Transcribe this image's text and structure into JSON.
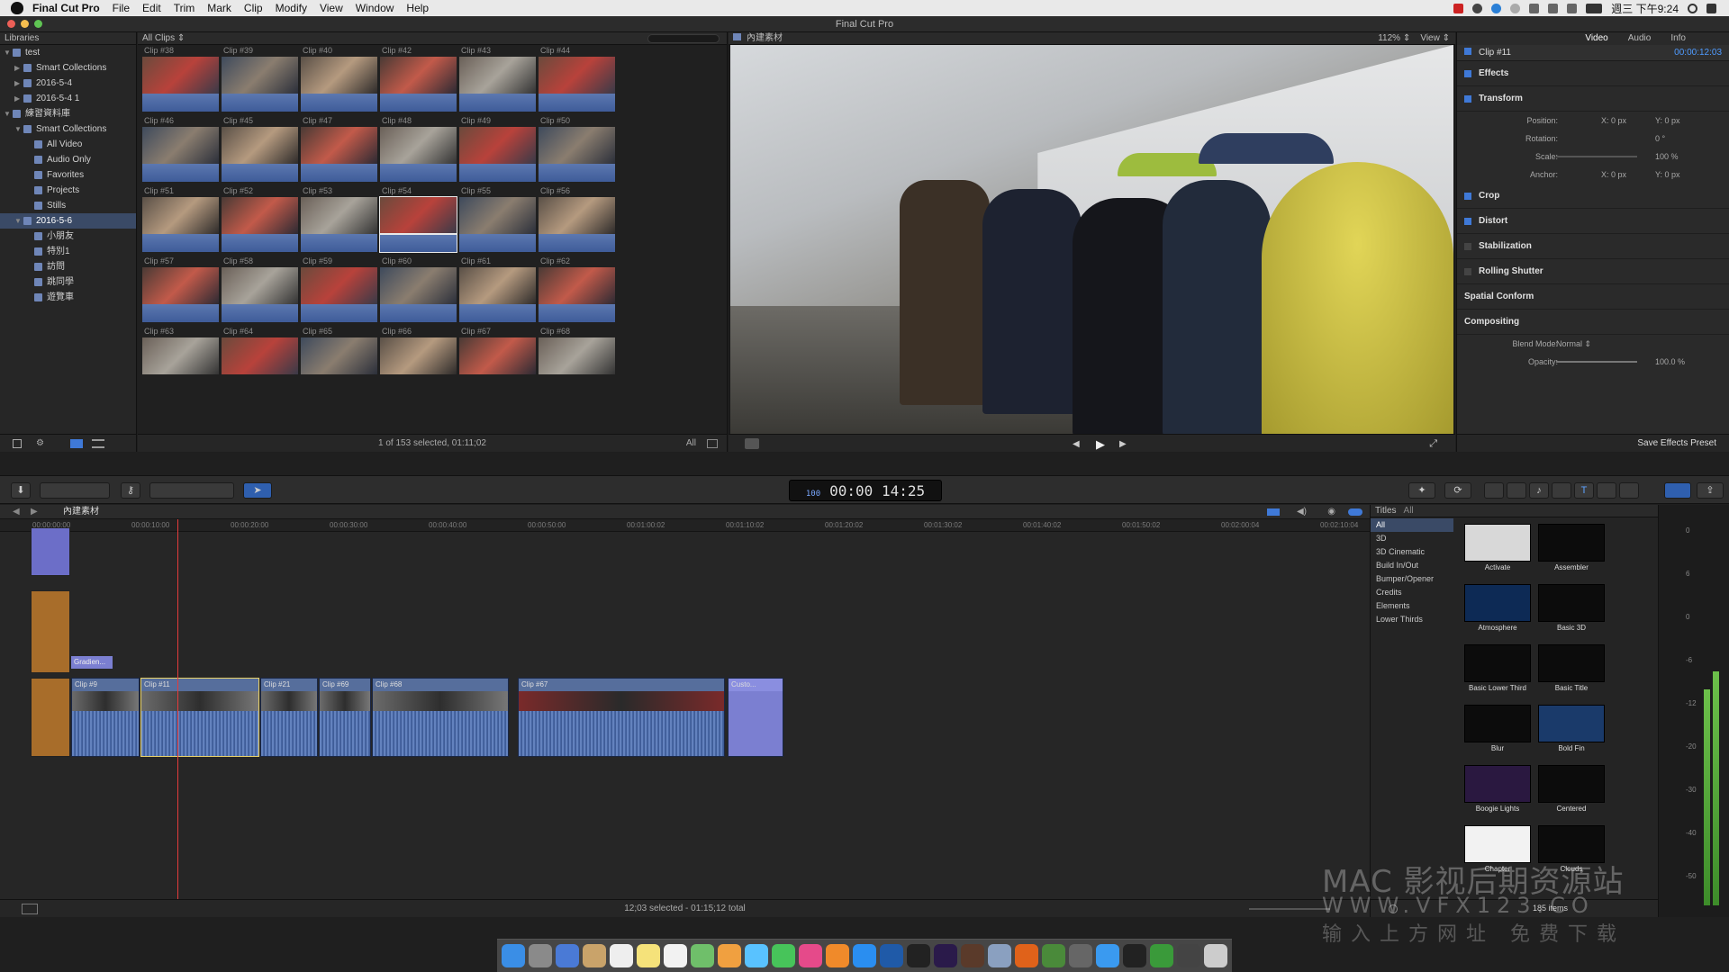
{
  "menubar": {
    "app": "Final Cut Pro",
    "items": [
      "File",
      "Edit",
      "Trim",
      "Mark",
      "Clip",
      "Modify",
      "View",
      "Window",
      "Help"
    ],
    "clock": "週三 下午9:24"
  },
  "window": {
    "title": "Final Cut Pro"
  },
  "libraries": {
    "header": "Libraries",
    "rows": [
      {
        "label": "test",
        "indent": 0,
        "tri": "▼"
      },
      {
        "label": "Smart Collections",
        "indent": 1,
        "tri": "▶"
      },
      {
        "label": "2016-5-4",
        "indent": 1,
        "tri": "▶"
      },
      {
        "label": "2016-5-4 1",
        "indent": 1,
        "tri": "▶"
      },
      {
        "label": "練習資料庫",
        "indent": 0,
        "tri": "▼"
      },
      {
        "label": "Smart Collections",
        "indent": 1,
        "tri": "▼"
      },
      {
        "label": "All Video",
        "indent": 2,
        "tri": ""
      },
      {
        "label": "Audio Only",
        "indent": 2,
        "tri": ""
      },
      {
        "label": "Favorites",
        "indent": 2,
        "tri": ""
      },
      {
        "label": "Projects",
        "indent": 2,
        "tri": ""
      },
      {
        "label": "Stills",
        "indent": 2,
        "tri": ""
      },
      {
        "label": "2016-5-6",
        "indent": 1,
        "tri": "▼",
        "selected": true
      },
      {
        "label": "小朋友",
        "indent": 2,
        "tri": ""
      },
      {
        "label": "特別1",
        "indent": 2,
        "tri": ""
      },
      {
        "label": "訪問",
        "indent": 2,
        "tri": ""
      },
      {
        "label": "跳同學",
        "indent": 2,
        "tri": ""
      },
      {
        "label": "遊覽車",
        "indent": 2,
        "tri": ""
      }
    ]
  },
  "browser": {
    "filter": "All Clips ⇕",
    "clips": [
      "Clip #38",
      "Clip #39",
      "Clip #40",
      "Clip #42",
      "Clip #43",
      "Clip #44",
      "Clip #46",
      "Clip #45",
      "Clip #47",
      "Clip #48",
      "Clip #49",
      "Clip #50",
      "Clip #51",
      "Clip #52",
      "Clip #53",
      "Clip #54",
      "Clip #55",
      "Clip #56",
      "Clip #57",
      "Clip #58",
      "Clip #59",
      "Clip #60",
      "Clip #61",
      "Clip #62",
      "Clip #63",
      "Clip #64",
      "Clip #65",
      "Clip #66",
      "Clip #67",
      "Clip #68"
    ],
    "selected_index": 15,
    "status": "1 of 153 selected, 01:11;02",
    "filter_short": "All"
  },
  "viewer": {
    "title": "內建素材",
    "zoom": "112% ⇕",
    "view_menu": "View ⇕"
  },
  "inspector": {
    "tabs": [
      "Video",
      "Audio",
      "Info"
    ],
    "clip_name": "Clip #11",
    "duration": "00:00:12:03",
    "sections": {
      "effects": "Effects",
      "transform": "Transform",
      "crop": "Crop",
      "distort": "Distort",
      "stabilization": "Stabilization",
      "rolling_shutter": "Rolling Shutter",
      "spatial_conform": "Spatial Conform",
      "compositing": "Compositing"
    },
    "transform": {
      "position_label": "Position:",
      "position_x": "X: 0 px",
      "position_y": "Y: 0 px",
      "rotation_label": "Rotation:",
      "rotation": "0 °",
      "scale_label": "Scale:",
      "scale": "100 %",
      "anchor_label": "Anchor:",
      "anchor_x": "X: 0 px",
      "anchor_y": "Y: 0 px"
    },
    "compositing": {
      "blend_label": "Blend Mode:",
      "blend": "Normal ⇕",
      "opacity_label": "Opacity:",
      "opacity": "100.0 %"
    },
    "save_button": "Save Effects Preset"
  },
  "toolbar": {
    "timecode": "00:00 14:25",
    "timecode_badge": "100"
  },
  "timeline": {
    "title": "內建素材",
    "ruler": [
      "00:00:00:00",
      "00:00:10:00",
      "00:00:20:00",
      "00:00:30:00",
      "00:00:40:00",
      "00:00:50:00",
      "00:01:00:02",
      "00:01:10:02",
      "00:01:20:02",
      "00:01:30:02",
      "00:01:40:02",
      "00:01:50:02",
      "00:02:00:04",
      "00:02:10:04"
    ],
    "clips": [
      "Clip #9",
      "Clip #11",
      "Clip #21",
      "Clip #69",
      "Clip #68",
      "Clip #67",
      "Custo..."
    ],
    "connected_label": "Gradien...",
    "status": "12;03 selected - 01:15;12 total"
  },
  "titles": {
    "header": "Titles",
    "filter": "All",
    "categories": [
      "All",
      "3D",
      "3D Cinematic",
      "Build In/Out",
      "Bumper/Opener",
      "Credits",
      "Elements",
      "Lower Thirds"
    ],
    "items": [
      "Activate",
      "Assembler",
      "Atmosphere",
      "Basic 3D",
      "Basic Lower Third",
      "Basic Title",
      "Blur",
      "Bold Fin",
      "Boogie Lights",
      "Centered",
      "Chapter",
      "Clouds"
    ],
    "count": "185 items"
  },
  "meter": {
    "scale": [
      "0",
      "6",
      "0",
      "-6",
      "-12",
      "-20",
      "-30",
      "-40",
      "-50"
    ]
  },
  "watermark": {
    "line1": "MAC 影视后期资源站",
    "line2": "WWW.VFX123.CO",
    "line3": "输入上方网址 免费下载"
  },
  "colors": {
    "accent": "#3f79d7",
    "selection": "#3a4a66",
    "waveform": "#3f5c99",
    "playhead": "#e43b3b"
  }
}
